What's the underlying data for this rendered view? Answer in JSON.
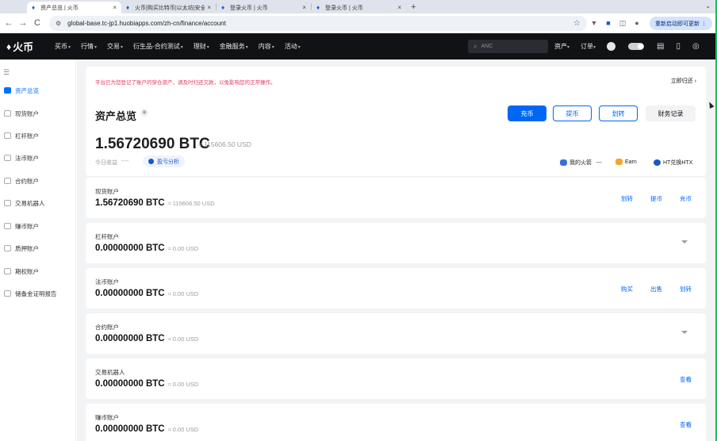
{
  "browser": {
    "tabs": [
      {
        "title": "资产总览 | 火币",
        "active": true
      },
      {
        "title": "火币|购买比特币|以太坊|安全交易",
        "active": false
      },
      {
        "title": "登录火币 | 火币",
        "active": false
      },
      {
        "title": "登录火币 | 火币",
        "active": false
      }
    ],
    "close_glyph": "×",
    "new_tab_glyph": "+",
    "tab_menu_glyph": "⌄",
    "back_glyph": "←",
    "forward_glyph": "→",
    "reload_glyph": "C",
    "url": "global-base.tc-jp1.huobiapps.com/zh-cn/finance/account",
    "relaunch_label": "重新启动即可更新"
  },
  "header": {
    "logo_text": "火币",
    "menu": [
      {
        "label": "买币"
      },
      {
        "label": "行情"
      },
      {
        "label": "交易"
      },
      {
        "label": "衍生品-合约测试"
      },
      {
        "label": "理财"
      },
      {
        "label": "金融服务"
      },
      {
        "label": "内容"
      },
      {
        "label": "活动"
      }
    ],
    "search_placeholder": "ANC",
    "right_menu": [
      {
        "label": "资产"
      },
      {
        "label": "订单"
      }
    ]
  },
  "sidebar": {
    "items": [
      {
        "label": "资产总览",
        "active": true
      },
      {
        "label": "现货账户"
      },
      {
        "label": "杠杆账户"
      },
      {
        "label": "法币账户"
      },
      {
        "label": "合约账户"
      },
      {
        "label": "交易机器人"
      },
      {
        "label": "赚币账户"
      },
      {
        "label": "质押账户"
      },
      {
        "label": "期权账户"
      },
      {
        "label": "储备金证明报告"
      }
    ]
  },
  "notice": {
    "text": "平台已为您登记了账户的穿仓资产，请及时归还欠款，以免影响您的正常操作。",
    "link": "立即归还 ›"
  },
  "overview": {
    "title": "资产总览",
    "buttons": {
      "deposit": "充币",
      "withdraw": "提币",
      "transfer": "划转",
      "records": "财务记录"
    },
    "total_btc": "1.56720690 BTC",
    "total_usd": "≈ 115606.50 USD",
    "today_label": "今日收益",
    "today_value": "----",
    "pnl_label": "盈亏分析",
    "quick_links": [
      {
        "label": "我的火箭",
        "value": "---"
      },
      {
        "label": "Earn"
      },
      {
        "label": "HT兑换HTX"
      }
    ],
    "colors": {
      "primary": "#0067f5",
      "notice": "#e0375c"
    }
  },
  "accounts": [
    {
      "name": "现货账户",
      "balance": "1.56720690 BTC",
      "usd": "≈ 115606.50 USD",
      "actions": [
        "划转",
        "提币",
        "充币"
      ]
    },
    {
      "name": "杠杆账户",
      "balance": "0.00000000 BTC",
      "usd": "≈ 0.00 USD",
      "actions": []
    },
    {
      "name": "法币账户",
      "balance": "0.00000000 BTC",
      "usd": "≈ 0.00 USD",
      "actions": [
        "购买",
        "出售",
        "划转"
      ]
    },
    {
      "name": "合约账户",
      "balance": "0.00000000 BTC",
      "usd": "≈ 0.00 USD",
      "actions": []
    },
    {
      "name": "交易机器人",
      "balance": "0.00000000 BTC",
      "usd": "≈ 0.00 USD",
      "actions": [
        "查看"
      ]
    },
    {
      "name": "赚币账户",
      "balance": "0.00000000 BTC",
      "usd": "≈ 0.00 USD",
      "actions": [
        "查看"
      ]
    }
  ]
}
